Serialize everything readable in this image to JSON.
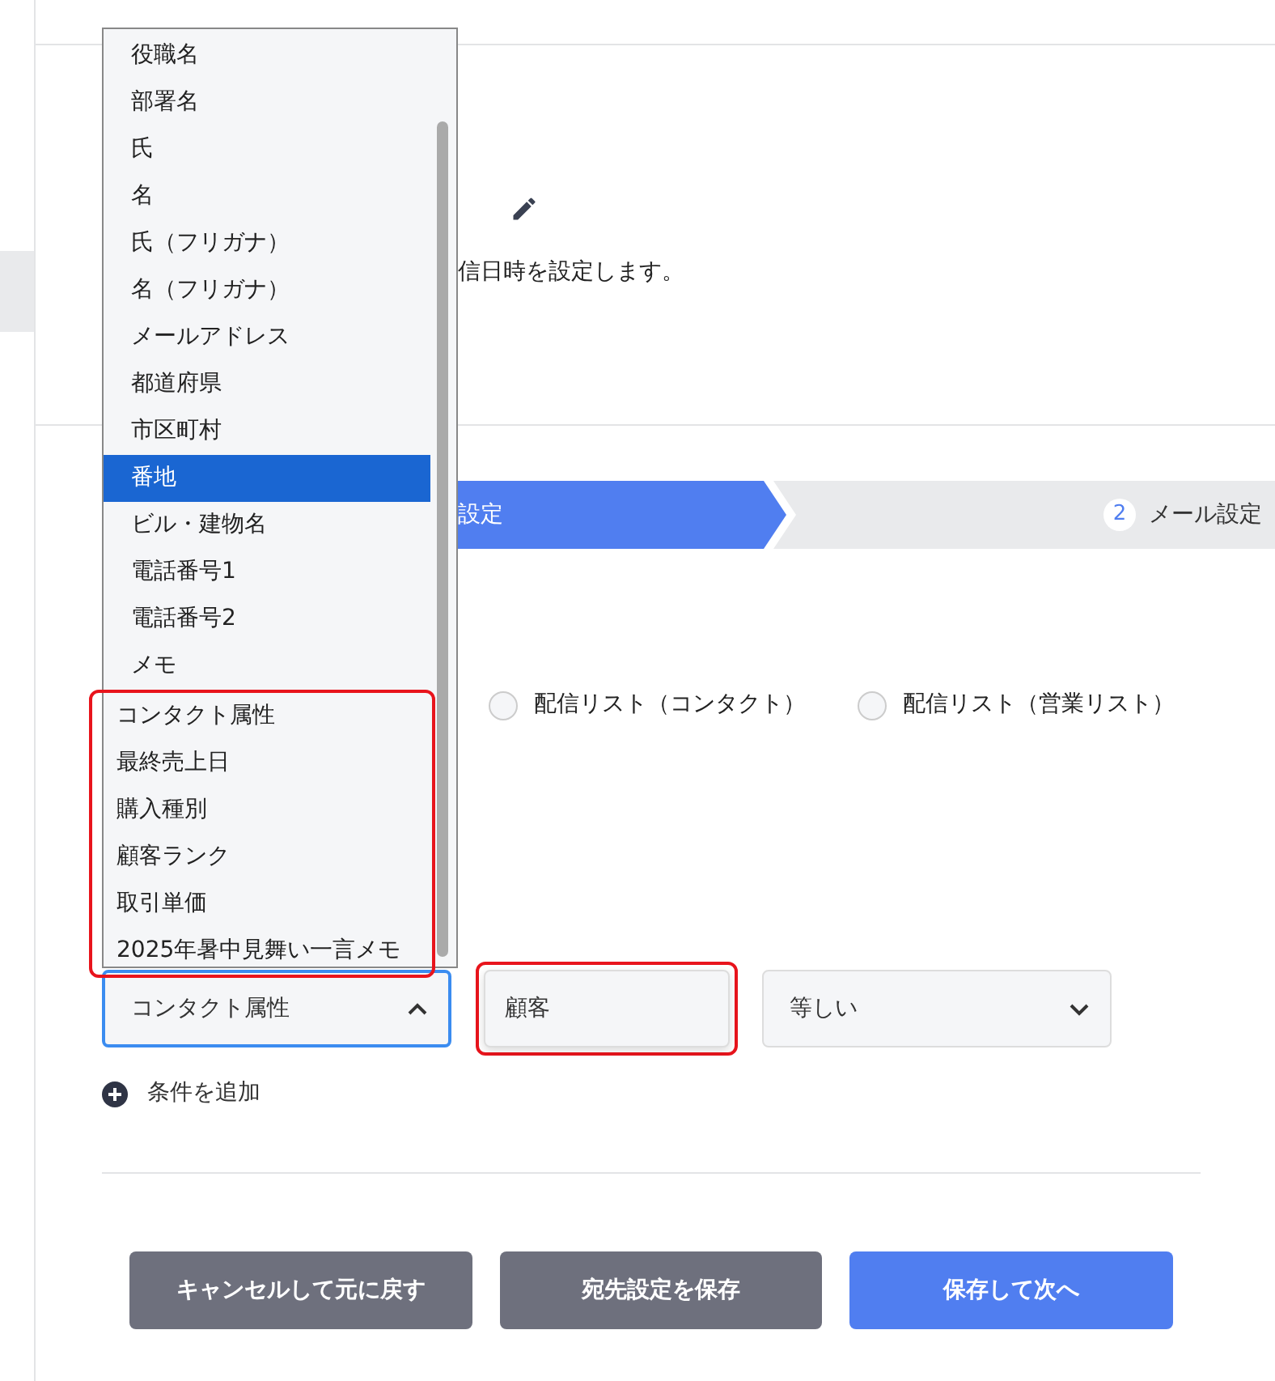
{
  "header": {
    "description": "信日時を設定します。"
  },
  "steps": [
    {
      "label": "設定",
      "selected": true
    },
    {
      "number": "2",
      "label": "メール設定",
      "selected": false
    }
  ],
  "recipient_types": [
    {
      "label": "配信リスト（コンタクト）",
      "selected": false
    },
    {
      "label": "配信リスト（営業リスト）",
      "selected": false
    }
  ],
  "dropdown": {
    "options": [
      {
        "label": "役職名",
        "selected": false,
        "highlighted": false
      },
      {
        "label": "部署名",
        "selected": false,
        "highlighted": false
      },
      {
        "label": "氏",
        "selected": false,
        "highlighted": false
      },
      {
        "label": "名",
        "selected": false,
        "highlighted": false
      },
      {
        "label": "氏（フリガナ）",
        "selected": false,
        "highlighted": false
      },
      {
        "label": "名（フリガナ）",
        "selected": false,
        "highlighted": false
      },
      {
        "label": "メールアドレス",
        "selected": false,
        "highlighted": false
      },
      {
        "label": "都道府県",
        "selected": false,
        "highlighted": false
      },
      {
        "label": "市区町村",
        "selected": false,
        "highlighted": false
      },
      {
        "label": "番地",
        "selected": true,
        "highlighted": false
      },
      {
        "label": "ビル・建物名",
        "selected": false,
        "highlighted": false
      },
      {
        "label": "電話番号1",
        "selected": false,
        "highlighted": false
      },
      {
        "label": "電話番号2",
        "selected": false,
        "highlighted": false
      },
      {
        "label": "メモ",
        "selected": false,
        "highlighted": false
      },
      {
        "label": "コンタクト属性",
        "selected": false,
        "highlighted": true
      },
      {
        "label": "最終売上日",
        "selected": false,
        "highlighted": true
      },
      {
        "label": "購入種別",
        "selected": false,
        "highlighted": true
      },
      {
        "label": "顧客ランク",
        "selected": false,
        "highlighted": true
      },
      {
        "label": "取引単価",
        "selected": false,
        "highlighted": true
      },
      {
        "label": "2025年暑中見舞い一言メモ",
        "selected": false,
        "highlighted": true
      }
    ]
  },
  "condition": {
    "field": {
      "value": "コンタクト属性",
      "expanded": true
    },
    "value": {
      "value": "顧客",
      "highlighted": true
    },
    "operator": {
      "value": "等しい",
      "expanded": false
    }
  },
  "add_condition": "条件を追加",
  "buttons": [
    {
      "label": "キャンセルして元に戻す",
      "kind": "secondary"
    },
    {
      "label": "宛先設定を保存",
      "kind": "secondary"
    },
    {
      "label": "保存して次へ",
      "kind": "primary"
    }
  ]
}
